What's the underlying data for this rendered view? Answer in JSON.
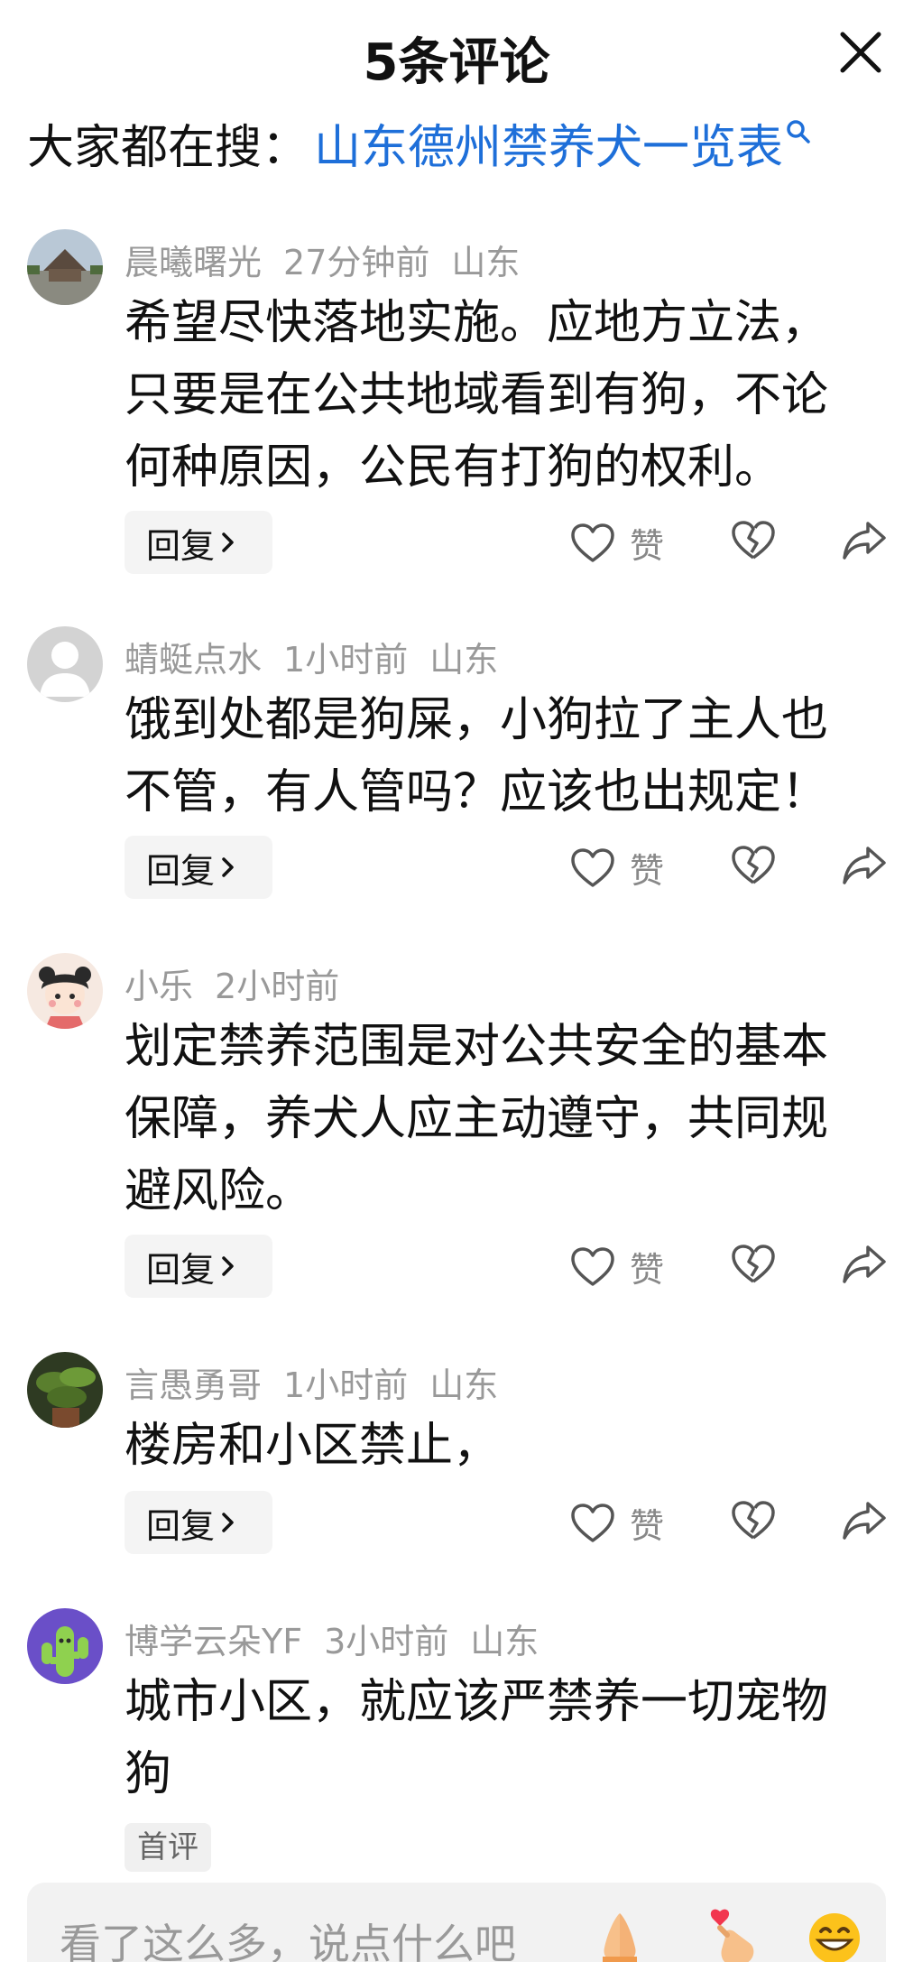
{
  "header": {
    "title": "5条评论",
    "close_icon": "close-icon"
  },
  "search": {
    "label": "大家都在搜：",
    "query": "山东德州禁养犬一览表",
    "icon": "search-icon"
  },
  "actions": {
    "reply_label": "回复",
    "like_label": "赞"
  },
  "comments": [
    {
      "user": "晨曦曙光",
      "time": "27分钟前",
      "location": "山东",
      "lines": [
        "希望尽快落地实施。应地方立法，",
        "只要是在公共地域看到有狗，不论",
        "何种原因，公民有打狗的权利。"
      ]
    },
    {
      "user": "蜻蜓点水",
      "time": "1小时前",
      "location": "山东",
      "lines": [
        "饿到处都是狗屎，小狗拉了主人也",
        "不管，有人管吗？应该也出规定！"
      ]
    },
    {
      "user": "小乐",
      "time": "2小时前",
      "location": "",
      "lines": [
        "划定禁养范围是对公共安全的基本",
        "保障，养犬人应主动遵守，共同规",
        "避风险。"
      ]
    },
    {
      "user": "言愚勇哥",
      "time": "1小时前",
      "location": "山东",
      "lines": [
        "楼房和小区禁止，"
      ]
    },
    {
      "user": "博学云朵YF",
      "time": "3小时前",
      "location": "山东",
      "lines": [
        "城市小区，就应该严禁养一切宠物",
        "狗"
      ],
      "badge": "首评"
    }
  ],
  "input": {
    "placeholder": "看了这么多，说点什么吧"
  },
  "colors": {
    "link": "#1e6fd9",
    "meta": "#999999",
    "reply_bg": "#f4f4f4"
  }
}
